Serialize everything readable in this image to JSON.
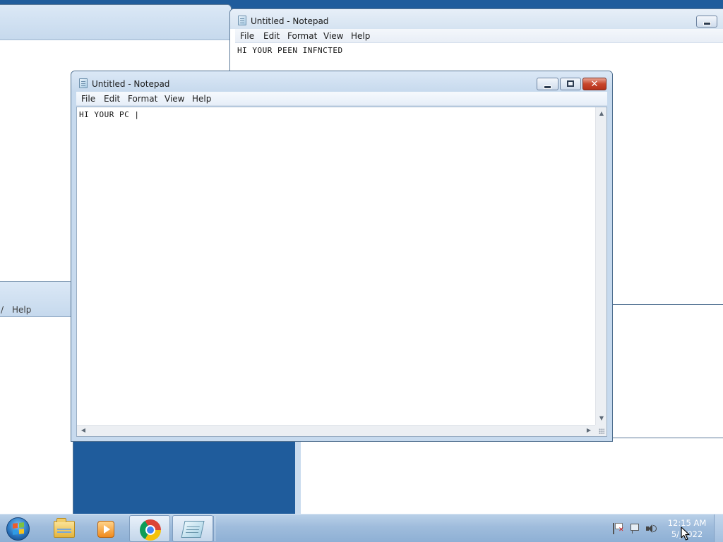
{
  "background_notepad": {
    "title": "Untitled - Notepad",
    "menu": [
      "File",
      "Edit",
      "Format",
      "View",
      "Help"
    ],
    "content": "HI YOUR PEEN INFNCTED"
  },
  "background_left_window": {
    "menu_help": "Help",
    "menu_cut": "/"
  },
  "main_notepad": {
    "title": "Untitled - Notepad",
    "menu": [
      "File",
      "Edit",
      "Format",
      "View",
      "Help"
    ],
    "content": "HI YOUR PC |"
  },
  "taskbar": {
    "buttons": [
      {
        "name": "start-button",
        "icon": "windows-logo-icon"
      },
      {
        "name": "explorer-button",
        "icon": "folder-icon"
      },
      {
        "name": "media-player-button",
        "icon": "media-player-icon"
      },
      {
        "name": "chrome-button",
        "icon": "chrome-icon"
      },
      {
        "name": "notepad-button",
        "icon": "notepad-icon"
      }
    ],
    "tray_icons": [
      "action-center-flag-icon",
      "network-icon",
      "volume-icon"
    ],
    "clock": {
      "time": "12:15 AM",
      "date": "5/‸2022"
    }
  },
  "colors": {
    "taskbar": "#9fbcdc",
    "window_frame": "#c7daee",
    "close_button": "#c7452b",
    "desktop": "#1f5c9c"
  }
}
